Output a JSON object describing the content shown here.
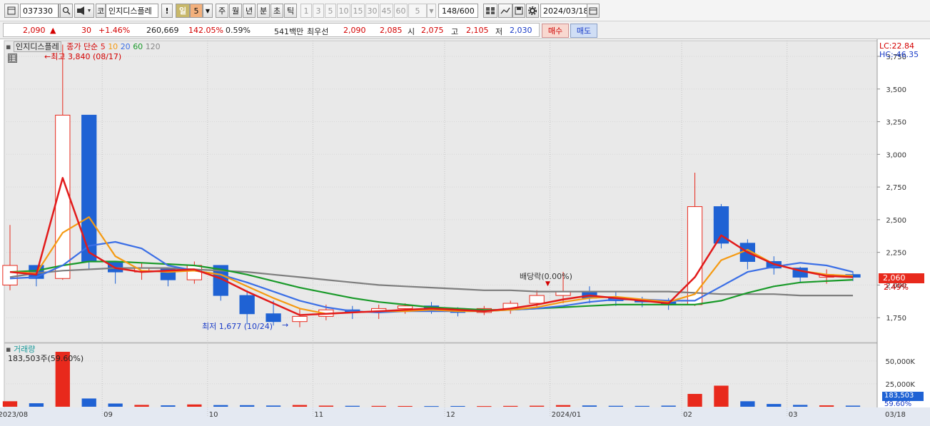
{
  "toolbar": {
    "code": "037330",
    "code_prefix": "코",
    "stock_name": "인지디스플레",
    "alert_label": "!",
    "period_day": "일",
    "period_value": "5",
    "period_week": "주",
    "period_month": "월",
    "period_year": "년",
    "period_minute": "분",
    "period_second": "초",
    "period_tick": "틱",
    "intervals": [
      "1",
      "3",
      "5",
      "10",
      "15",
      "30",
      "45",
      "60"
    ],
    "interval_value": "5",
    "count": "148",
    "count_total": "/600",
    "date": "2024/03/18"
  },
  "quote": {
    "price": "2,090",
    "arrow": "▲",
    "change": "30",
    "change_pct": "+1.46%",
    "volume": "260,669",
    "volume_ratio": "142.05%",
    "turnover": "0.59%",
    "amount": "541백만",
    "best_bid_label": "최우선",
    "best_ask": "2,090",
    "best_bid": "2,085",
    "open_label": "시",
    "open": "2,075",
    "high_label": "고",
    "high": "2,105",
    "low_label": "저",
    "low": "2,030",
    "buy_label": "매수",
    "sell_label": "매도"
  },
  "price_panel": {
    "name": "인지디스플레",
    "legend_prefix": "종가 단순",
    "ma_periods": [
      "5",
      "10",
      "20",
      "60",
      "120"
    ],
    "lc": "LC:22.84",
    "hc": "HC:-46.35",
    "high_annotation": "←최고 3,840 (08/17)",
    "low_annotation": "최저 1,677 (10/24)",
    "low_arrow": "→",
    "dividend_label": "배당락(0.00%)",
    "current_price_tag": "2,060",
    "current_pct_tag": "2.49%"
  },
  "volume_panel": {
    "title": "거래량",
    "max_label": "183,503주(59.60%)",
    "current_tag": "183,503",
    "current_pct": "59.60%"
  },
  "colors": {
    "up": "#e8291c",
    "down": "#1f62d4",
    "ma5": "#e21b1b",
    "ma10": "#f59a12",
    "ma20": "#3b6fe6",
    "ma60": "#1a9a2a",
    "ma120": "#7e7e7e",
    "grid": "#d8d8d8"
  },
  "chart_data": {
    "type": "candlestick",
    "y_ticks": [
      1750,
      2000,
      2250,
      2500,
      2750,
      3000,
      3250,
      3500,
      3750
    ],
    "ylim": [
      1560,
      3870
    ],
    "volume_ticks": [
      25000,
      50000
    ],
    "volume_tick_labels": [
      "25,000K",
      "50,000K"
    ],
    "volume_ylim": [
      0,
      60000
    ],
    "x_labels": [
      "2023/08",
      "09",
      "10",
      "11",
      "12",
      "2024/01",
      "02",
      "03"
    ],
    "x_label_index": [
      0,
      4,
      8,
      12,
      17,
      21,
      26,
      30
    ],
    "right_date_label": "03/18",
    "candles": [
      [
        2000,
        2460,
        1960,
        2150
      ],
      [
        2150,
        2120,
        1990,
        2050
      ],
      [
        2050,
        3840,
        2040,
        3300
      ],
      [
        3300,
        2600,
        2120,
        2180
      ],
      [
        2180,
        2140,
        2010,
        2100
      ],
      [
        2100,
        2170,
        2040,
        2130
      ],
      [
        2130,
        2110,
        1990,
        2040
      ],
      [
        2040,
        2180,
        2010,
        2150
      ],
      [
        2150,
        2130,
        1880,
        1920
      ],
      [
        1920,
        1960,
        1700,
        1780
      ],
      [
        1780,
        1880,
        1690,
        1720
      ],
      [
        1720,
        1820,
        1677,
        1760
      ],
      [
        1760,
        1850,
        1730,
        1810
      ],
      [
        1810,
        1840,
        1740,
        1790
      ],
      [
        1790,
        1850,
        1740,
        1820
      ],
      [
        1820,
        1860,
        1780,
        1840
      ],
      [
        1840,
        1870,
        1780,
        1820
      ],
      [
        1820,
        1830,
        1760,
        1790
      ],
      [
        1790,
        1840,
        1770,
        1820
      ],
      [
        1820,
        1880,
        1780,
        1860
      ],
      [
        1860,
        1960,
        1820,
        1920
      ],
      [
        1920,
        2100,
        1860,
        1950
      ],
      [
        1950,
        1990,
        1860,
        1900
      ],
      [
        1900,
        1950,
        1840,
        1880
      ],
      [
        1880,
        1910,
        1830,
        1870
      ],
      [
        1870,
        1900,
        1810,
        1850
      ],
      [
        1850,
        2860,
        1840,
        2600
      ],
      [
        2600,
        2620,
        2280,
        2320
      ],
      [
        2320,
        2350,
        2120,
        2180
      ],
      [
        2180,
        2220,
        2080,
        2130
      ],
      [
        2130,
        2140,
        2020,
        2060
      ],
      [
        2060,
        2120,
        2010,
        2080
      ],
      [
        2080,
        2105,
        2030,
        2060
      ]
    ],
    "ma": {
      "5": [
        2100,
        2080,
        2820,
        2250,
        2130,
        2100,
        2110,
        2120,
        2050,
        1950,
        1860,
        1770,
        1780,
        1790,
        1800,
        1810,
        1820,
        1810,
        1800,
        1820,
        1850,
        1890,
        1920,
        1900,
        1880,
        1860,
        2060,
        2380,
        2250,
        2160,
        2110,
        2070,
        2060
      ],
      "10": [
        2100,
        2090,
        2400,
        2520,
        2220,
        2110,
        2100,
        2110,
        2080,
        1990,
        1900,
        1820,
        1780,
        1790,
        1800,
        1800,
        1810,
        1800,
        1800,
        1810,
        1830,
        1870,
        1900,
        1910,
        1890,
        1870,
        1930,
        2190,
        2270,
        2160,
        2110,
        2080,
        2070
      ],
      "20": [
        2050,
        2060,
        2150,
        2300,
        2330,
        2280,
        2150,
        2110,
        2080,
        2020,
        1950,
        1880,
        1830,
        1800,
        1790,
        1800,
        1800,
        1800,
        1800,
        1810,
        1820,
        1840,
        1870,
        1890,
        1890,
        1880,
        1880,
        1990,
        2100,
        2140,
        2170,
        2150,
        2100
      ],
      "60": [
        2100,
        2110,
        2150,
        2180,
        2180,
        2170,
        2160,
        2150,
        2120,
        2080,
        2030,
        1980,
        1940,
        1900,
        1870,
        1850,
        1830,
        1820,
        1810,
        1810,
        1820,
        1830,
        1840,
        1850,
        1850,
        1850,
        1850,
        1880,
        1940,
        1990,
        2020,
        2030,
        2040
      ],
      "120": [
        2060,
        2090,
        2110,
        2120,
        2130,
        2130,
        2130,
        2120,
        2110,
        2100,
        2080,
        2060,
        2040,
        2020,
        2000,
        1990,
        1980,
        1970,
        1960,
        1960,
        1950,
        1950,
        1950,
        1950,
        1950,
        1950,
        1940,
        1930,
        1930,
        1930,
        1920,
        1920,
        1920
      ]
    },
    "volume": [
      6000,
      3800,
      60000,
      9000,
      3500,
      2000,
      1500,
      2500,
      1800,
      1700,
      1300,
      1900,
      1200,
      1000,
      900,
      800,
      700,
      800,
      700,
      900,
      1100,
      1800,
      1400,
      1000,
      900,
      1200,
      14000,
      23000,
      6000,
      3000,
      2000,
      1500,
      1200
    ],
    "volume_up": [
      true,
      false,
      true,
      false,
      false,
      true,
      false,
      true,
      false,
      false,
      false,
      true,
      true,
      false,
      true,
      true,
      false,
      false,
      true,
      true,
      true,
      true,
      false,
      false,
      false,
      false,
      true,
      true,
      false,
      false,
      false,
      true,
      false
    ]
  }
}
